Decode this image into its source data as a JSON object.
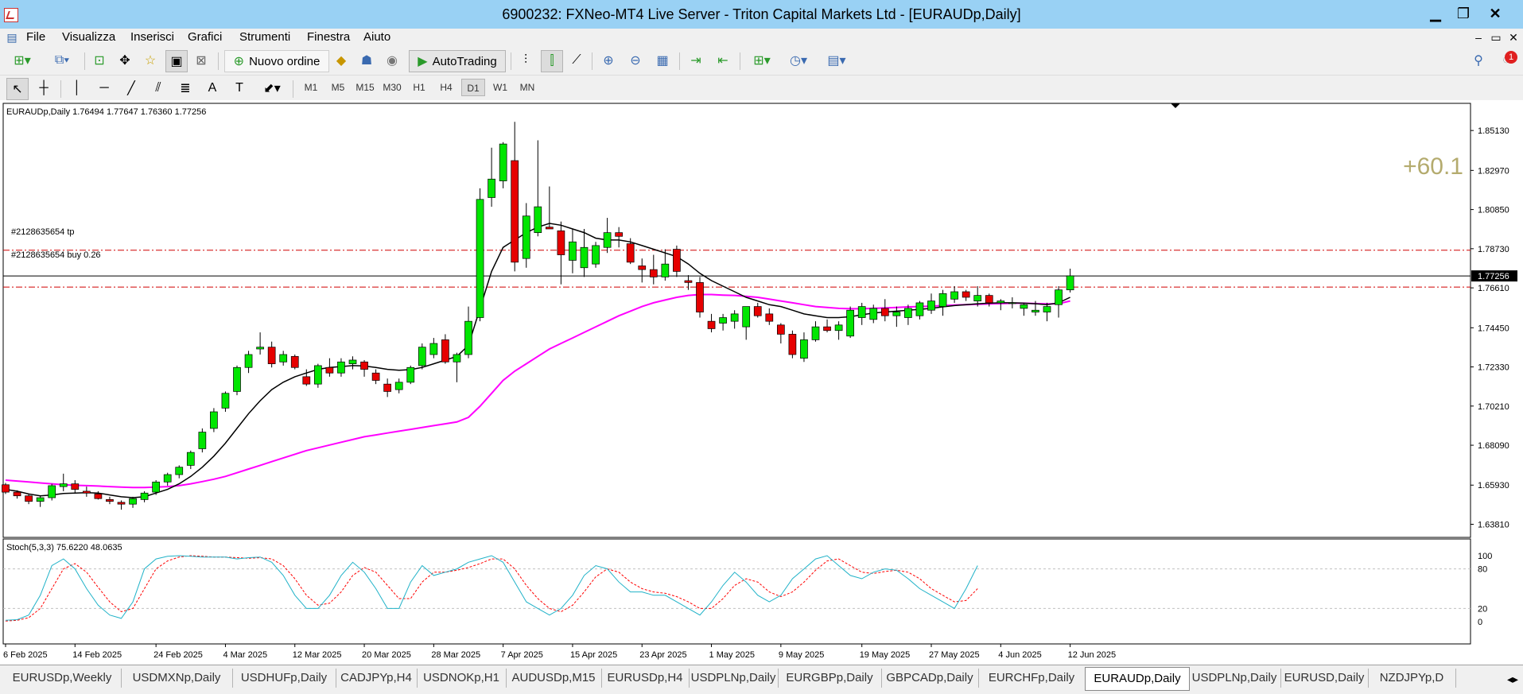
{
  "window": {
    "title": "6900232: FXNeo-MT4 Live Server - Triton Capital Markets Ltd - [EURAUDp,Daily]",
    "minimize_icon": "minimize-icon",
    "maximize_icon": "restore-icon",
    "close_icon": "close-icon"
  },
  "menu": {
    "items": [
      "File",
      "Visualizza",
      "Inserisci",
      "Grafici",
      "Strumenti",
      "Finestra",
      "Aiuto"
    ],
    "mdi_buttons": [
      "–",
      "▭",
      "✕"
    ]
  },
  "toolbar": {
    "new_order_label": "Nuovo ordine",
    "autotrading_label": "AutoTrading",
    "notification_count": "1"
  },
  "timeframes": [
    "M1",
    "M5",
    "M15",
    "M30",
    "H1",
    "H4",
    "D1",
    "W1",
    "MN"
  ],
  "active_timeframe": "D1",
  "chart": {
    "header": "EURAUDp,Daily  1.76494 1.77647 1.76360 1.77256",
    "profit_label": "+60.1",
    "tp_label": "#2128635654 tp",
    "buy_label": "#2128635654 buy 0.26",
    "current_price_label": "1.77256",
    "price_axis": [
      "1.85130",
      "1.82970",
      "1.80850",
      "1.78730",
      "1.76610",
      "1.74450",
      "1.72330",
      "1.70210",
      "1.68090",
      "1.65930",
      "1.63810"
    ],
    "stoch_label": "Stoch(5,3,3) 75.6220 48.0635",
    "stoch_axis": [
      "100",
      "80",
      "20",
      "0"
    ],
    "date_axis": [
      "6 Feb 2025",
      "14 Feb 2025",
      "24 Feb 2025",
      "4 Mar 2025",
      "12 Mar 2025",
      "20 Mar 2025",
      "28 Mar 2025",
      "7 Apr 2025",
      "15 Apr 2025",
      "23 Apr 2025",
      "1 May 2025",
      "9 May 2025",
      "19 May 2025",
      "27 May 2025",
      "4 Jun 2025",
      "12 Jun 2025"
    ],
    "colors": {
      "bull": "#00e600",
      "bear": "#e60000",
      "ma_fast": "#000000",
      "ma_slow": "#ff00ff",
      "stoch_main": "#20b2c8",
      "stoch_signal": "#ff0000",
      "level_line": "#d00000",
      "profit": "#b4ab6e"
    }
  },
  "tabs": [
    "EURUSDp,Weekly",
    "USDMXNp,Daily",
    "USDHUFp,Daily",
    "CADJPYp,H4",
    "USDNOKp,H1",
    "AUDUSDp,M15",
    "EURUSDp,H4",
    "USDPLNp,Daily",
    "EURGBPp,Daily",
    "GBPCADp,Daily",
    "EURCHFp,Daily",
    "EURAUDp,Daily",
    "USDPLNp,Daily",
    "EURUSD,Daily",
    "NZDJPYp,D"
  ],
  "active_tab": "EURAUDp,Daily",
  "chart_data": {
    "type": "candlestick",
    "symbol": "EURAUDp",
    "timeframe": "Daily",
    "ohlc": [
      [
        1.6595,
        1.6605,
        1.6545,
        1.6555
      ],
      [
        1.6555,
        1.6565,
        1.652,
        1.6535
      ],
      [
        1.6535,
        1.6545,
        1.649,
        1.6505
      ],
      [
        1.6505,
        1.6535,
        1.6475,
        1.6525
      ],
      [
        1.6525,
        1.66,
        1.651,
        1.659
      ],
      [
        1.6585,
        1.6655,
        1.656,
        1.66
      ],
      [
        1.66,
        1.662,
        1.655,
        1.657
      ],
      [
        1.656,
        1.6585,
        1.653,
        1.655
      ],
      [
        1.6545,
        1.656,
        1.6515,
        1.652
      ],
      [
        1.6515,
        1.653,
        1.649,
        1.6505
      ],
      [
        1.65,
        1.651,
        1.646,
        1.649
      ],
      [
        1.649,
        1.653,
        1.647,
        1.652
      ],
      [
        1.6515,
        1.656,
        1.65,
        1.655
      ],
      [
        1.6555,
        1.662,
        1.654,
        1.661
      ],
      [
        1.661,
        1.666,
        1.659,
        1.665
      ],
      [
        1.665,
        1.67,
        1.663,
        1.669
      ],
      [
        1.67,
        1.678,
        1.668,
        1.677
      ],
      [
        1.679,
        1.69,
        1.677,
        1.688
      ],
      [
        1.69,
        1.701,
        1.688,
        1.699
      ],
      [
        1.701,
        1.71,
        1.699,
        1.709
      ],
      [
        1.71,
        1.724,
        1.708,
        1.723
      ],
      [
        1.723,
        1.732,
        1.72,
        1.73
      ],
      [
        1.733,
        1.742,
        1.73,
        1.734
      ],
      [
        1.734,
        1.737,
        1.723,
        1.725
      ],
      [
        1.726,
        1.732,
        1.724,
        1.73
      ],
      [
        1.729,
        1.73,
        1.722,
        1.723
      ],
      [
        1.718,
        1.722,
        1.713,
        1.714
      ],
      [
        1.714,
        1.725,
        1.712,
        1.724
      ],
      [
        1.723,
        1.728,
        1.718,
        1.72
      ],
      [
        1.72,
        1.728,
        1.718,
        1.726
      ],
      [
        1.725,
        1.729,
        1.722,
        1.727
      ],
      [
        1.726,
        1.727,
        1.718,
        1.722
      ],
      [
        1.72,
        1.722,
        1.714,
        1.716
      ],
      [
        1.714,
        1.717,
        1.707,
        1.71
      ],
      [
        1.711,
        1.717,
        1.709,
        1.715
      ],
      [
        1.715,
        1.724,
        1.714,
        1.723
      ],
      [
        1.724,
        1.736,
        1.722,
        1.734
      ],
      [
        1.73,
        1.739,
        1.728,
        1.736
      ],
      [
        1.738,
        1.741,
        1.725,
        1.726
      ],
      [
        1.726,
        1.731,
        1.715,
        1.73
      ],
      [
        1.73,
        1.756,
        1.728,
        1.748
      ],
      [
        1.75,
        1.82,
        1.748,
        1.814
      ],
      [
        1.815,
        1.842,
        1.81,
        1.825
      ],
      [
        1.824,
        1.845,
        1.82,
        1.844
      ],
      [
        1.835,
        1.856,
        1.775,
        1.78
      ],
      [
        1.782,
        1.812,
        1.777,
        1.805
      ],
      [
        1.796,
        1.846,
        1.794,
        1.81
      ],
      [
        1.799,
        1.821,
        1.798,
        1.798
      ],
      [
        1.797,
        1.802,
        1.768,
        1.784
      ],
      [
        1.781,
        1.798,
        1.774,
        1.791
      ],
      [
        1.777,
        1.798,
        1.772,
        1.788
      ],
      [
        1.779,
        1.791,
        1.777,
        1.789
      ],
      [
        1.788,
        1.804,
        1.785,
        1.796
      ],
      [
        1.796,
        1.799,
        1.788,
        1.794
      ],
      [
        1.79,
        1.793,
        1.779,
        1.78
      ],
      [
        1.778,
        1.782,
        1.769,
        1.776
      ],
      [
        1.776,
        1.784,
        1.768,
        1.772
      ],
      [
        1.772,
        1.787,
        1.77,
        1.779
      ],
      [
        1.787,
        1.789,
        1.772,
        1.775
      ],
      [
        1.77,
        1.773,
        1.765,
        1.769
      ],
      [
        1.769,
        1.772,
        1.75,
        1.753
      ],
      [
        1.748,
        1.752,
        1.742,
        1.744
      ],
      [
        1.747,
        1.752,
        1.743,
        1.75
      ],
      [
        1.748,
        1.754,
        1.744,
        1.752
      ],
      [
        1.745,
        1.756,
        1.738,
        1.756
      ],
      [
        1.756,
        1.758,
        1.75,
        1.751
      ],
      [
        1.752,
        1.755,
        1.746,
        1.748
      ],
      [
        1.746,
        1.747,
        1.736,
        1.741
      ],
      [
        1.741,
        1.743,
        1.728,
        1.73
      ],
      [
        1.728,
        1.742,
        1.726,
        1.738
      ],
      [
        1.738,
        1.748,
        1.737,
        1.745
      ],
      [
        1.745,
        1.749,
        1.742,
        1.743
      ],
      [
        1.743,
        1.748,
        1.738,
        1.746
      ],
      [
        1.74,
        1.756,
        1.739,
        1.754
      ],
      [
        1.75,
        1.758,
        1.746,
        1.756
      ],
      [
        1.749,
        1.757,
        1.747,
        1.755
      ],
      [
        1.755,
        1.76,
        1.748,
        1.751
      ],
      [
        1.751,
        1.756,
        1.745,
        1.753
      ],
      [
        1.75,
        1.757,
        1.746,
        1.755
      ],
      [
        1.751,
        1.759,
        1.749,
        1.758
      ],
      [
        1.754,
        1.763,
        1.752,
        1.759
      ],
      [
        1.756,
        1.765,
        1.751,
        1.763
      ],
      [
        1.76,
        1.767,
        1.758,
        1.764
      ],
      [
        1.764,
        1.765,
        1.759,
        1.761
      ],
      [
        1.759,
        1.767,
        1.756,
        1.762
      ],
      [
        1.762,
        1.763,
        1.756,
        1.758
      ],
      [
        1.758,
        1.76,
        1.754,
        1.759
      ],
      [
        1.758,
        1.761,
        1.755,
        1.758
      ],
      [
        1.755,
        1.758,
        1.751,
        1.757
      ],
      [
        1.753,
        1.759,
        1.751,
        1.754
      ],
      [
        1.753,
        1.758,
        1.748,
        1.756
      ],
      [
        1.757,
        1.767,
        1.75,
        1.765
      ],
      [
        1.765,
        1.7765,
        1.7636,
        1.7726
      ]
    ],
    "ma_fast": [
      1.657,
      1.656,
      1.6545,
      1.6535,
      1.654,
      1.6548,
      1.655,
      1.6552,
      1.655,
      1.654,
      1.653,
      1.6525,
      1.653,
      1.655,
      1.657,
      1.66,
      1.664,
      1.669,
      1.675,
      1.682,
      1.69,
      1.698,
      1.705,
      1.711,
      1.715,
      1.718,
      1.72,
      1.722,
      1.723,
      1.7235,
      1.724,
      1.7238,
      1.723,
      1.722,
      1.7215,
      1.7218,
      1.723,
      1.725,
      1.727,
      1.729,
      1.735,
      1.755,
      1.775,
      1.788,
      1.792,
      1.796,
      1.799,
      1.801,
      1.8,
      1.798,
      1.796,
      1.793,
      1.792,
      1.792,
      1.791,
      1.789,
      1.787,
      1.785,
      1.783,
      1.779,
      1.774,
      1.77,
      1.767,
      1.764,
      1.761,
      1.759,
      1.757,
      1.756,
      1.754,
      1.752,
      1.751,
      1.75,
      1.75,
      1.7505,
      1.7515,
      1.7525,
      1.753,
      1.7535,
      1.754,
      1.7545,
      1.755,
      1.7558,
      1.7565,
      1.757,
      1.7575,
      1.7578,
      1.758,
      1.758,
      1.7578,
      1.7575,
      1.757,
      1.758,
      1.761
    ],
    "ma_slow": [
      1.662,
      1.6615,
      1.661,
      1.6605,
      1.66,
      1.6595,
      1.6592,
      1.659,
      1.6588,
      1.6585,
      1.6582,
      1.658,
      1.658,
      1.6582,
      1.6585,
      1.659,
      1.66,
      1.6612,
      1.6625,
      1.664,
      1.666,
      1.668,
      1.67,
      1.672,
      1.674,
      1.676,
      1.678,
      1.6795,
      1.681,
      1.6825,
      1.684,
      1.6855,
      1.6865,
      1.6875,
      1.6885,
      1.6895,
      1.6905,
      1.6915,
      1.6925,
      1.6935,
      1.696,
      1.702,
      1.709,
      1.716,
      1.721,
      1.725,
      1.729,
      1.733,
      1.736,
      1.739,
      1.742,
      1.745,
      1.748,
      1.751,
      1.7535,
      1.756,
      1.758,
      1.7595,
      1.761,
      1.762,
      1.7625,
      1.7625,
      1.7622,
      1.762,
      1.7615,
      1.761,
      1.76,
      1.759,
      1.758,
      1.757,
      1.756,
      1.7555,
      1.755,
      1.7548,
      1.7548,
      1.755,
      1.7552,
      1.7555,
      1.7558,
      1.756,
      1.7562,
      1.7565,
      1.7568,
      1.757,
      1.7572,
      1.7574,
      1.7576,
      1.7578,
      1.7578,
      1.7576,
      1.7574,
      1.7575,
      1.759
    ],
    "stoch_main": [
      2,
      3,
      10,
      40,
      85,
      95,
      80,
      50,
      25,
      10,
      5,
      30,
      80,
      95,
      99,
      100,
      99,
      98,
      98,
      98,
      95,
      97,
      98,
      90,
      70,
      40,
      20,
      20,
      40,
      70,
      90,
      75,
      50,
      20,
      20,
      60,
      85,
      70,
      75,
      80,
      90,
      95,
      100,
      90,
      60,
      30,
      20,
      10,
      20,
      40,
      70,
      85,
      80,
      60,
      45,
      45,
      40,
      40,
      30,
      20,
      10,
      30,
      55,
      75,
      60,
      40,
      30,
      40,
      65,
      80,
      95,
      100,
      85,
      70,
      65,
      75,
      80,
      78,
      65,
      50,
      40,
      30,
      20,
      50,
      85
    ],
    "stoch_signal": [
      1,
      2,
      6,
      20,
      50,
      80,
      88,
      75,
      52,
      30,
      15,
      20,
      50,
      80,
      92,
      98,
      100,
      99,
      98,
      98,
      97,
      96,
      97,
      95,
      85,
      65,
      40,
      25,
      28,
      45,
      70,
      82,
      75,
      55,
      35,
      35,
      60,
      75,
      75,
      78,
      82,
      88,
      95,
      95,
      80,
      55,
      35,
      20,
      15,
      25,
      45,
      68,
      80,
      75,
      60,
      50,
      45,
      43,
      38,
      30,
      20,
      20,
      35,
      55,
      65,
      60,
      45,
      38,
      45,
      60,
      78,
      92,
      95,
      85,
      75,
      73,
      76,
      78,
      75,
      65,
      50,
      40,
      30,
      32,
      50
    ],
    "trade_levels": {
      "tp": 1.7865,
      "buy": 1.7665,
      "current": 1.77256
    },
    "ylim": [
      1.631,
      1.866
    ],
    "stoch_levels": [
      20,
      80
    ]
  }
}
